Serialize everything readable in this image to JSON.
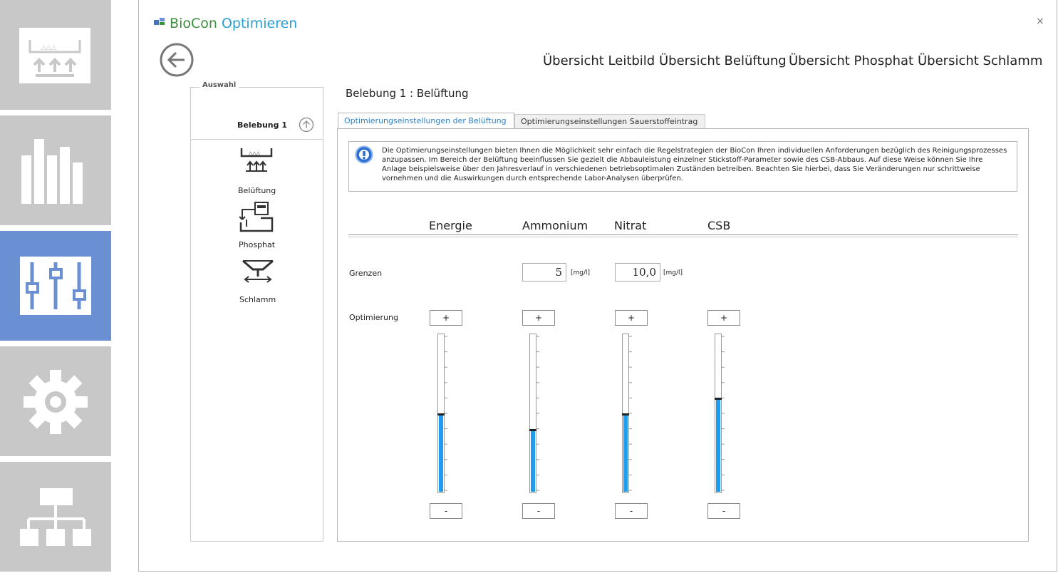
{
  "app": {
    "title_part1": "BioCon",
    "title_part2": "Optimieren",
    "close_glyph": "×"
  },
  "topnav": [
    "Übersicht Leitbild",
    "Übersicht Belüftung",
    "Übersicht Phosphat",
    "Übersicht Schlamm"
  ],
  "sidebar_group": {
    "label": "Auswahl",
    "selected": "Belebung 1",
    "items": [
      {
        "label": "Belüftung",
        "icon": "aeration-icon"
      },
      {
        "label": "Phosphat",
        "icon": "phosphate-icon"
      },
      {
        "label": "Schlamm",
        "icon": "sludge-icon"
      }
    ]
  },
  "page_title": "Belebung 1 : Belüftung",
  "tabs": [
    {
      "label": "Optimierungseinstellungen der Belüftung",
      "active": true
    },
    {
      "label": "Optimierungseinstellungen Sauerstoffeintrag",
      "active": false
    }
  ],
  "info_text": "Die Optimierungseinstellungen bieten Ihnen die Möglichkeit sehr einfach die Regelstrategien der BioCon Ihren individuellen Anforderungen bezüglich des Reinigungsprozesses anzupassen. Im Bereich der Belüftung beeinflussen Sie gezielt die Abbauleistung einzelner Stickstoff-Parameter sowie des CSB-Abbaus. Auf diese Weise können Sie Ihre Anlage beispielsweise über den Jahresverlauf in verschiedenen betriebsoptimalen Zuständen betreiben. Beachten Sie hierbei, dass Sie Veränderungen nur schrittweise vornehmen und die Auswirkungen durch entsprechende Labor-Analysen überprüfen.",
  "columns": [
    "Energie",
    "Ammonium",
    "Nitrat",
    "CSB"
  ],
  "grenzen": {
    "label": "Grenzen",
    "ammonium": {
      "value": "5",
      "unit": "[mg/l]"
    },
    "nitrat": {
      "value": "10,0",
      "unit": "[mg/l]"
    }
  },
  "optimierung": {
    "label": "Optimierung",
    "plus": "+",
    "minus": "-",
    "levels": {
      "energie": 0.49,
      "ammonium": 0.39,
      "nitrat": 0.49,
      "csb": 0.59
    }
  },
  "colors": {
    "accent": "#2a9fd6",
    "rail_active": "#6b8fd3",
    "rail": "#c8c8c8",
    "slider_fill": "#1e9cf0"
  },
  "rail_icons": [
    "aeration-icon",
    "bar-chart-icon",
    "sliders-icon",
    "gear-icon",
    "hierarchy-icon"
  ]
}
